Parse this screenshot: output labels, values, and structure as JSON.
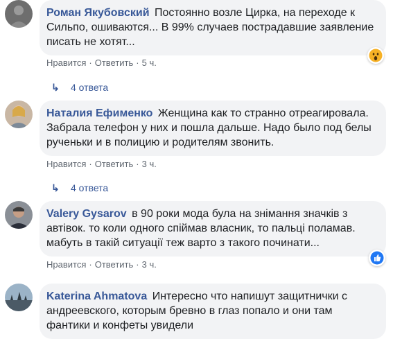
{
  "comments": [
    {
      "author": "Роман Якубовский",
      "text": "Постоянно возле Цирка, на переходе к Сильпо, ошиваются... В 99% случаев пострадавшие заявление писать не хотят...",
      "like_label": "Нравится",
      "reply_label": "Ответить",
      "time": "5 ч.",
      "replies_label": "4 ответа",
      "reaction_icon": "wow-reaction-icon"
    },
    {
      "author": "Наталия Ефименко",
      "text": "Женщина как то странно отреагировала. Забрала телефон у них и пошла дальше. Надо было под белы рученьки и в полицию и родителям звонить.",
      "like_label": "Нравится",
      "reply_label": "Ответить",
      "time": "3 ч.",
      "replies_label": "4 ответа"
    },
    {
      "author": "Valery Gysarov",
      "text": "в 90 роки мода була на знімання значків з автівок. то коли одного спіймав власник, то пальці поламав. мабуть в такій ситуації теж варто з такого починати...",
      "like_label": "Нравится",
      "reply_label": "Ответить",
      "time": "3 ч.",
      "reaction_icon": "like-reaction-icon"
    },
    {
      "author": "Katerina Ahmatova",
      "text": "Интересно что напишут защитнички с андреевского, которым бревно в глаз попало и они там фантики и конфеты увидели"
    }
  ],
  "colors": {
    "author": "#385898",
    "bubble": "#f2f3f5",
    "meta": "#606770",
    "like_blue": "#2078f4",
    "wow_yellow": "#f7b125"
  }
}
